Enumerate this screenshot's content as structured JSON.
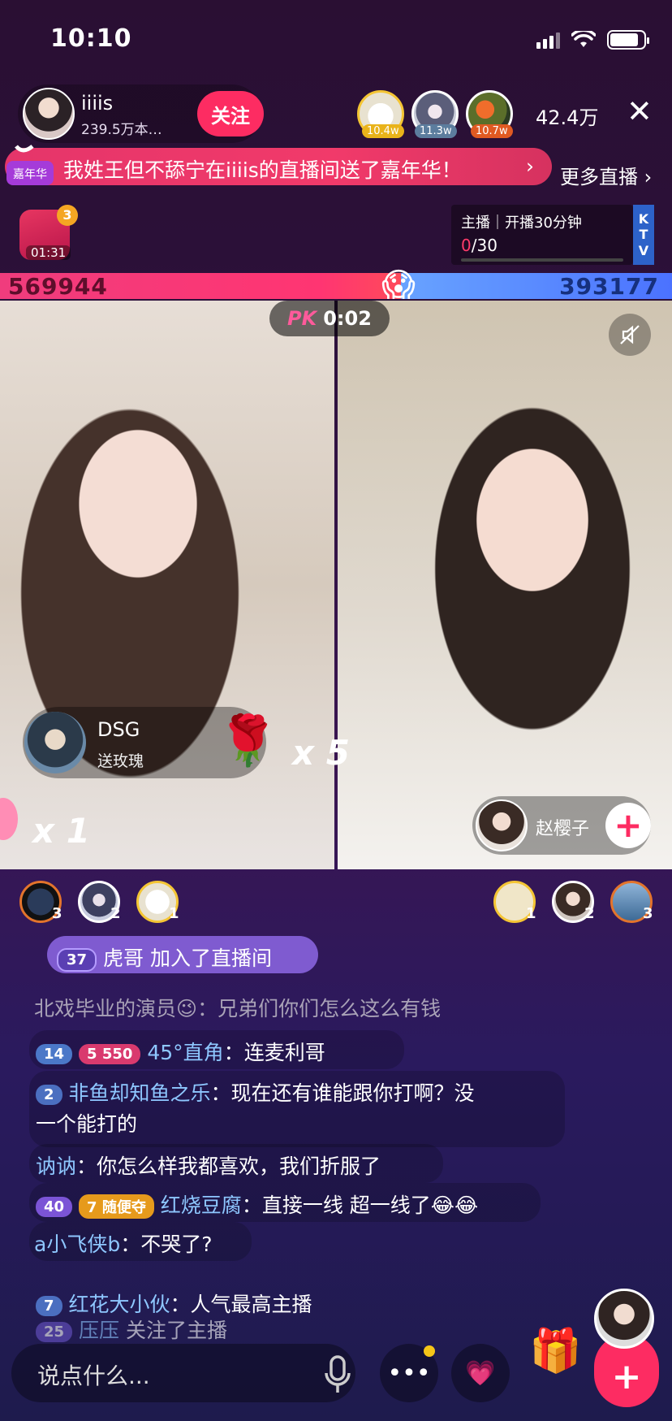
{
  "status_bar": {
    "time": "10:10"
  },
  "host": {
    "name": "iiiis",
    "fans": "239.5万本…",
    "follow_label": "关注"
  },
  "top_viewers": [
    {
      "badge": "10.4w",
      "badge_color": "#e9b31a"
    },
    {
      "badge": "11.3w",
      "badge_color": "#5c7d9e"
    },
    {
      "badge": "10.7w",
      "badge_color": "#e05a22"
    }
  ],
  "viewer_count": "42.4万",
  "banner": {
    "badge": "嘉年华",
    "text": "我姓王但不舔宁在iiiis的直播间送了嘉年华！",
    "more_live": "更多直播"
  },
  "gift_box": {
    "count": "3",
    "timer": "01:31"
  },
  "task": {
    "label": "主播｜开播30分钟",
    "progress_done": "0",
    "progress_total": "/30",
    "ktv": [
      "K",
      "T",
      "V"
    ]
  },
  "pk": {
    "left_score": "569944",
    "right_score": "393177",
    "logo": "PK",
    "timer": "0:02",
    "left_share": 0.596
  },
  "gift_event": {
    "user": "DSG",
    "action": "送玫瑰",
    "count": "x 5"
  },
  "left_combo": "x 1",
  "guest": {
    "name": "赵樱子"
  },
  "ranking_left": [
    "3",
    "2",
    "1"
  ],
  "ranking_right": [
    "1",
    "2",
    "3"
  ],
  "join_msg": {
    "level": "37",
    "text": "虎哥 加入了直播间"
  },
  "chat": [
    {
      "user": "北戏毕业的演员",
      "emoji": "😉",
      "text": "兄弟们你们怎么这么有钱"
    },
    {
      "level": "14",
      "fan_level": "5",
      "fan_value": "550",
      "user": "45°直角",
      "text": "连麦利哥"
    },
    {
      "level": "2",
      "user": "非鱼却知鱼之乐",
      "text": "现在还有谁能跟你打啊？没",
      "text2": "一个能打的"
    },
    {
      "user": "讷讷",
      "text": "你怎么样我都喜欢，我们折服了"
    },
    {
      "level": "40",
      "fan_level": "7",
      "fan_value": "随便夺",
      "user": "红烧豆腐",
      "text": "直接一线 超一线了😂😂"
    },
    {
      "user": "a小飞侠b",
      "text": "不哭了?"
    },
    {
      "level": "7",
      "user": "红花大小伙",
      "text": "人气最高主播"
    },
    {
      "level": "25",
      "user": "压压",
      "text": "关注了主播"
    }
  ],
  "input": {
    "placeholder": "说点什么..."
  },
  "colors": {
    "accent": "#fd2c62",
    "pk_left": "#ff3572",
    "pk_right": "#4b72ff"
  }
}
